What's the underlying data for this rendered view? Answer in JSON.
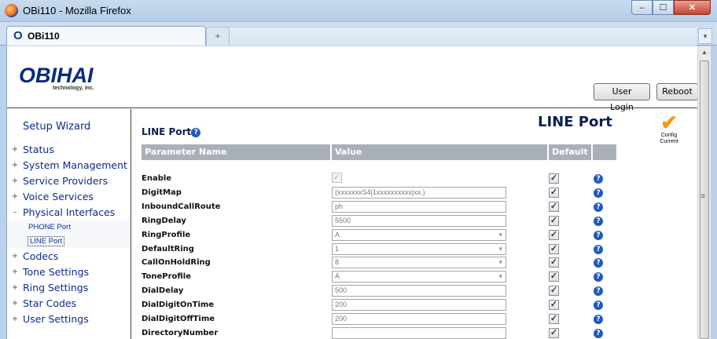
{
  "window": {
    "title": "OBi110 - Mozilla Firefox",
    "minimize": "–",
    "maximize": "☐",
    "close": "✕"
  },
  "browser": {
    "tab_label": "OBi110",
    "tab_icon": "O",
    "new_tab": "+",
    "tab_dropdown": "▾"
  },
  "header": {
    "logo": "OBIHAI",
    "logo_sub": "technology, inc.",
    "login_label": "User Login",
    "reboot_label": "Reboot"
  },
  "sidebar": {
    "wizard": "Setup Wizard",
    "items": [
      {
        "pm": "+",
        "label": "Status"
      },
      {
        "pm": "+",
        "label": "System Management"
      },
      {
        "pm": "+",
        "label": "Service Providers"
      },
      {
        "pm": "+",
        "label": "Voice Services"
      },
      {
        "pm": "–",
        "label": "Physical Interfaces"
      },
      {
        "pm": "+",
        "label": "Codecs"
      },
      {
        "pm": "+",
        "label": "Tone Settings"
      },
      {
        "pm": "+",
        "label": "Ring Settings"
      },
      {
        "pm": "+",
        "label": "Star Codes"
      },
      {
        "pm": "+",
        "label": "User Settings"
      }
    ],
    "subitems": [
      {
        "label": "PHONE Port"
      },
      {
        "label": "LINE Port"
      }
    ]
  },
  "main": {
    "page_title": "LINE Port",
    "section_title": "LINE Port",
    "help_glyph": "?",
    "config_check": "✔",
    "config_line1": "Config",
    "config_line2": "Current",
    "columns": {
      "name": "Parameter Name",
      "value": "Value",
      "default": "Default"
    },
    "rows": [
      {
        "name": "Enable",
        "type": "checkbox",
        "value": "✓",
        "default": "✓"
      },
      {
        "name": "DigitMap",
        "type": "text",
        "value": "(xxxxxxxS4|1xxxxxxxxxx|xx.)",
        "default": "✓"
      },
      {
        "name": "InboundCallRoute",
        "type": "text",
        "value": "ph",
        "default": "✓"
      },
      {
        "name": "RingDelay",
        "type": "text",
        "value": "5500",
        "default": "✓"
      },
      {
        "name": "RingProfile",
        "type": "select",
        "value": "A",
        "default": "✓"
      },
      {
        "name": "DefaultRing",
        "type": "select",
        "value": "1",
        "default": "✓"
      },
      {
        "name": "CallOnHoldRing",
        "type": "select",
        "value": "8",
        "default": "✓"
      },
      {
        "name": "ToneProfile",
        "type": "select",
        "value": "A",
        "default": "✓"
      },
      {
        "name": "DialDelay",
        "type": "text",
        "value": "500",
        "default": "✓"
      },
      {
        "name": "DialDigitOnTime",
        "type": "text",
        "value": "200",
        "default": "✓"
      },
      {
        "name": "DialDigitOffTime",
        "type": "text",
        "value": "200",
        "default": "✓"
      },
      {
        "name": "DirectoryNumber",
        "type": "text",
        "value": "",
        "default": "✓"
      }
    ]
  }
}
